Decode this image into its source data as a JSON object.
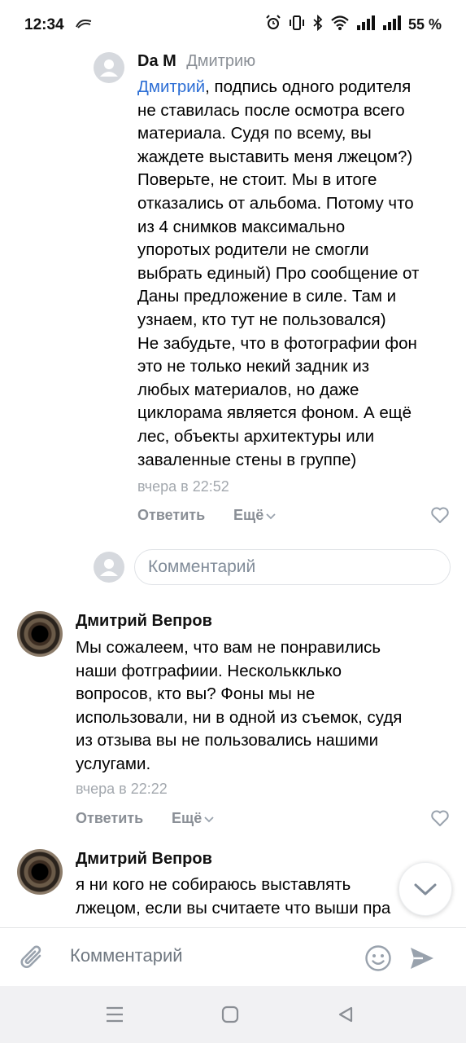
{
  "status_bar": {
    "time": "12:34",
    "battery": "55 %"
  },
  "comment_reply": {
    "author": "Da M",
    "reply_to": "Дмитрию",
    "mention": "Дмитрий",
    "lines": [
      ", подпись одного родителя",
      "не ставилась после осмотра всего",
      "материала. Судя по всему, вы",
      "жаждете выставить меня лжецом?)",
      "Поверьте, не стоит. Мы в итоге",
      "отказались от альбома. Потому что",
      "из 4 снимков максимально",
      "упоротых родители не смогли",
      "выбрать единый) Про сообщение от",
      "Даны предложение в силе. Там и",
      "узнаем, кто тут не пользовался)",
      "Не забудьте, что в фотографии фон",
      "это не только некий задник из",
      "любых материалов, но даже",
      "циклорама является фоном. А ещё",
      "лес, объекты архитектуры или",
      "заваленные стены в группе)"
    ],
    "time": "вчера в 22:52",
    "reply_label": "Ответить",
    "more_label": "Ещё"
  },
  "reply_input": {
    "placeholder": "Комментарий"
  },
  "comment_2": {
    "author": "Дмитрий Вепров",
    "lines": [
      "Мы сожалеем, что вам не понравились",
      "наши фотграфиии. Несколькклько",
      "вопросов, кто вы? Фоны мы не",
      "использовали, ни в одной из съемок, судя",
      "из отзыва вы не пользовались нашими",
      "услугами."
    ],
    "time": "вчера в 22:22",
    "reply_label": "Ответить",
    "more_label": "Ещё"
  },
  "comment_3": {
    "author": "Дмитрий Вепров",
    "lines": [
      "я ни кого не собираюсь выставлять",
      "лжецом, если вы считаете что выши пра"
    ]
  },
  "composer": {
    "placeholder": "Комментарий"
  },
  "colors": {
    "mention": "#2c6ed5",
    "muted": "#8a8f96",
    "timestamp": "#a3a8ae",
    "accent_icon": "#99a2ad"
  },
  "icons": {
    "status": [
      "app-notification-icon",
      "alarm-icon",
      "vibrate-icon",
      "bluetooth-icon",
      "wifi-icon",
      "signal-icon",
      "signal-icon"
    ],
    "actions": [
      "heart-icon",
      "chevron-down-icon",
      "attach-icon",
      "emoji-icon",
      "send-icon"
    ],
    "nav": [
      "menu-icon",
      "home-icon",
      "back-icon"
    ]
  }
}
